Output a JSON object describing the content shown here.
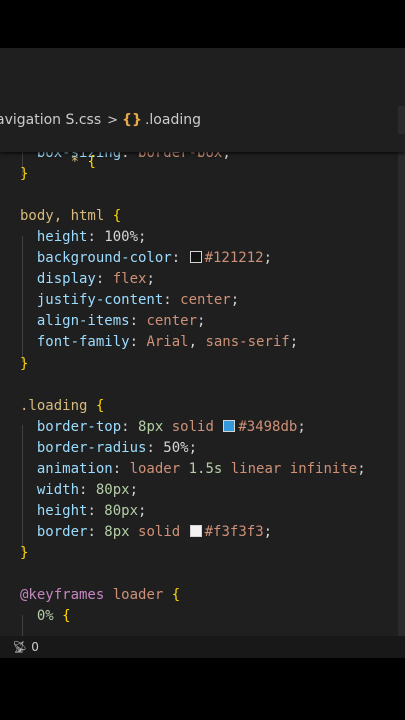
{
  "breadcrumb": {
    "file": "avigation S.css",
    "separator": ">",
    "symbol_icon": "css-selector-icon",
    "symbol": ".loading"
  },
  "sticky_header": {
    "text": "* {"
  },
  "code": [
    "  box-sizing: border-box;",
    "}",
    "",
    "body, html {",
    "  height: 100%;",
    "  background-color: #121212;",
    "  display: flex;",
    "  justify-content: center;",
    "  align-items: center;",
    "  font-family: Arial, sans-serif;",
    "}",
    "",
    ".loading {",
    "  border-top: 8px solid #3498db;",
    "  border-radius: 50%;",
    "  animation: loader 1.5s linear infinite;",
    "  width: 80px;",
    "  height: 80px;",
    "  border: 8px solid #f3f3f3;",
    "}",
    "",
    "@keyframes loader {",
    "  0% {"
  ],
  "colors": {
    "swatch_1": "#121212",
    "swatch_2": "#3498db",
    "swatch_3": "#f3f3f3"
  },
  "statusbar": {
    "icon": "broadcast-icon",
    "count": "0"
  }
}
